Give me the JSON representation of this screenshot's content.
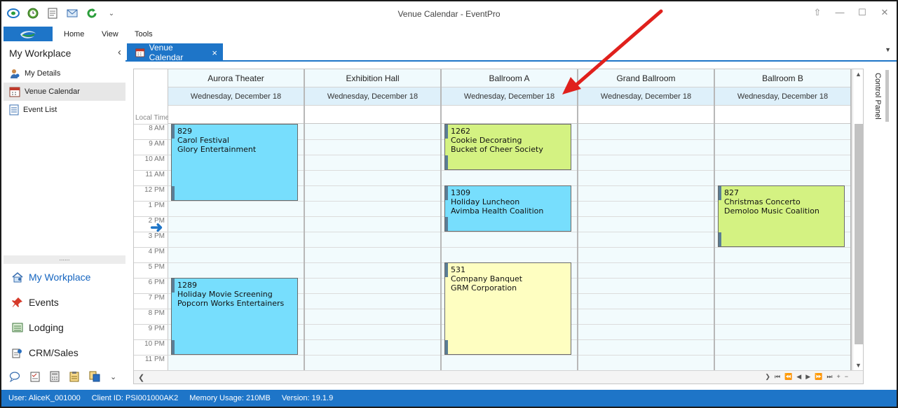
{
  "window": {
    "title": "Venue Calendar - EventPro"
  },
  "ribbon": {
    "tabs": [
      "Home",
      "View",
      "Tools"
    ]
  },
  "sidebar": {
    "title": "My Workplace",
    "items": [
      {
        "label": "My Details",
        "icon": "person-icon"
      },
      {
        "label": "Venue Calendar",
        "icon": "calendar-icon"
      },
      {
        "label": "Event List",
        "icon": "list-icon"
      }
    ],
    "nav": [
      {
        "label": "My Workplace",
        "icon": "home-icon"
      },
      {
        "label": "Events",
        "icon": "pushpin-icon"
      },
      {
        "label": "Lodging",
        "icon": "lodging-icon"
      },
      {
        "label": "CRM/Sales",
        "icon": "crm-icon"
      }
    ],
    "splitter": "......"
  },
  "doc_tab": {
    "label": "Venue Calendar",
    "close": "×"
  },
  "calendar": {
    "local_time_label": "Local Time",
    "times": [
      "8 AM",
      "9 AM",
      "10 AM",
      "11 AM",
      "12 PM",
      "1 PM",
      "2 PM",
      "3 PM",
      "4 PM",
      "5 PM",
      "6 PM",
      "7 PM",
      "8 PM",
      "9 PM",
      "10 PM",
      "11 PM"
    ],
    "venues": [
      {
        "name": "Aurora Theater",
        "date": "Wednesday, December 18"
      },
      {
        "name": "Exhibition Hall",
        "date": "Wednesday, December 18"
      },
      {
        "name": "Ballroom A",
        "date": "Wednesday, December 18"
      },
      {
        "name": "Grand Ballroom",
        "date": "Wednesday, December 18"
      },
      {
        "name": "Ballroom B",
        "date": "Wednesday, December 18"
      }
    ],
    "events": [
      {
        "id": "829",
        "title": "Carol Festival",
        "client": "Glory Entertainment",
        "venue": 0,
        "start": 8,
        "end": 13,
        "color": "#77defd"
      },
      {
        "id": "1289",
        "title": "Holiday Movie Screening",
        "client": "Popcorn Works Entertainers",
        "venue": 0,
        "start": 18,
        "end": 23,
        "color": "#77defd"
      },
      {
        "id": "1262",
        "title": "Cookie Decorating",
        "client": "Bucket of Cheer Society",
        "venue": 2,
        "start": 8,
        "end": 11,
        "color": "#d4f282"
      },
      {
        "id": "1309",
        "title": "Holiday Luncheon",
        "client": "Avimba Health Coalition",
        "venue": 2,
        "start": 12,
        "end": 15,
        "color": "#77defd"
      },
      {
        "id": "531",
        "title": "Company Banquet",
        "client": "GRM Corporation",
        "venue": 2,
        "start": 17,
        "end": 23,
        "color": "#fefec1"
      },
      {
        "id": "827",
        "title": "Christmas Concerto",
        "client": "Demoloo Music Coalition",
        "venue": 4,
        "start": 12,
        "end": 16,
        "color": "#d4f282"
      }
    ]
  },
  "control_panel": {
    "label": "Control Panel"
  },
  "status": {
    "user": "User: AliceK_001000",
    "client": "Client ID: PSI001000AK2",
    "memory": "Memory Usage: 210MB",
    "version": "Version: 19.1.9"
  },
  "colors": {
    "accent": "#1e75c8",
    "annotation": "#e0201c"
  }
}
